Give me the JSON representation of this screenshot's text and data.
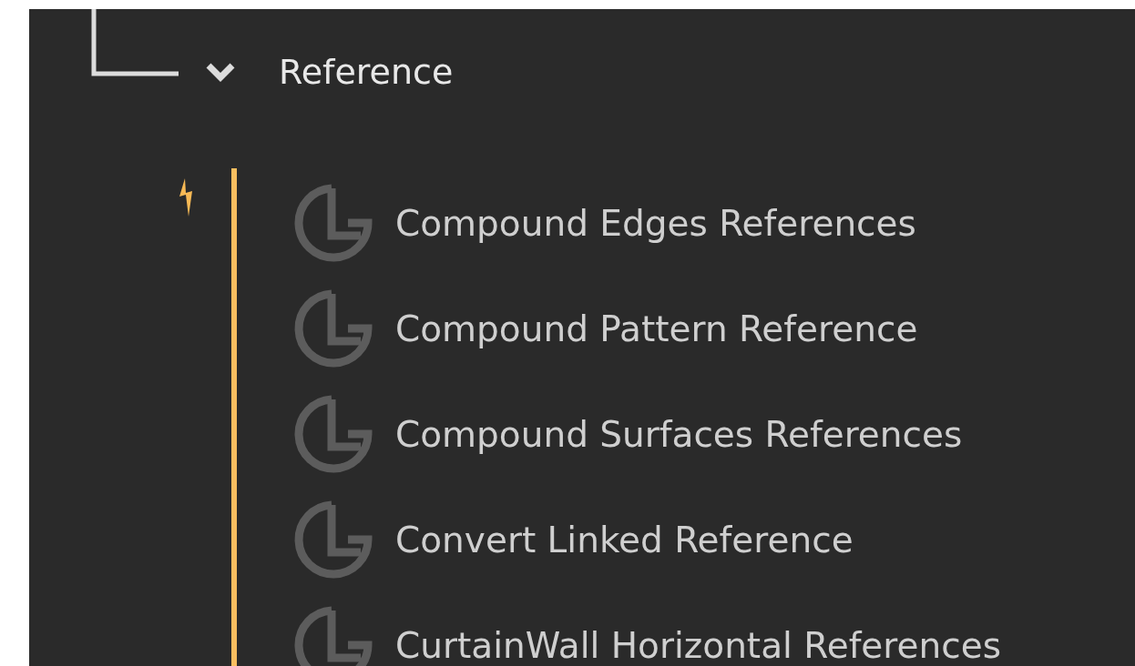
{
  "category": {
    "label": "Reference",
    "expanded": true
  },
  "items": [
    {
      "label": "Compound Edges References"
    },
    {
      "label": "Compound Pattern Reference"
    },
    {
      "label": "Compound Surfaces References"
    },
    {
      "label": "Convert Linked Reference"
    },
    {
      "label": "CurtainWall Horizontal References"
    }
  ]
}
